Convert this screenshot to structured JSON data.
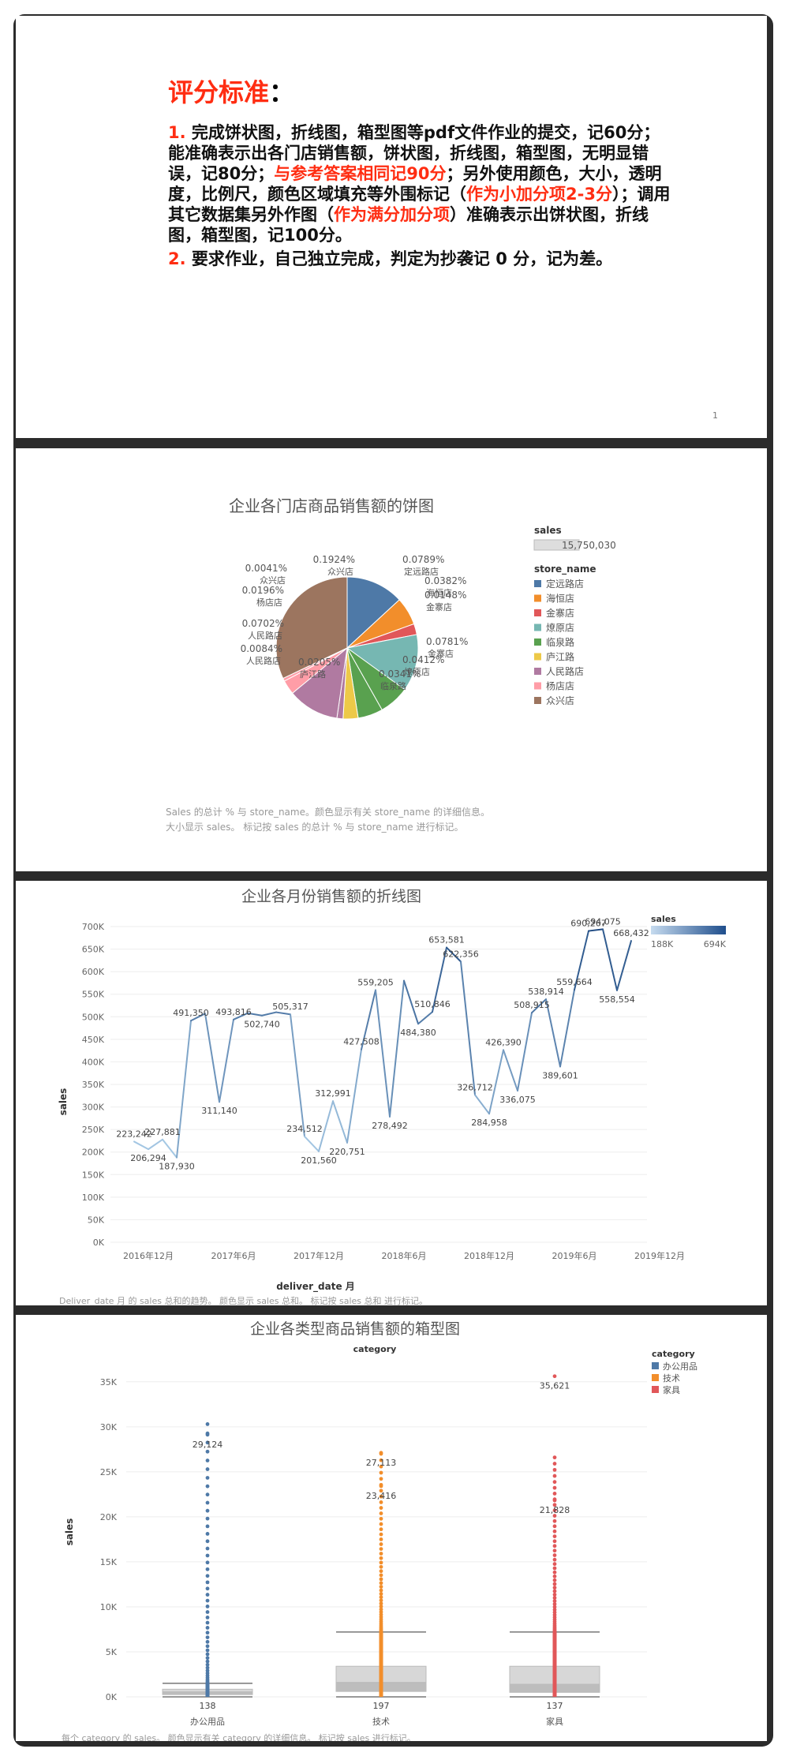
{
  "slide1": {
    "title_red": "评分标准",
    "title_colon": "：",
    "p1": [
      {
        "t": "1. ",
        "red": true
      },
      {
        "t": "完成饼状图，折线图，箱型图等pdf文件作业的提交，记60分；能准确表示出各门店销售额，饼状图，折线图，箱型图，无明显错误，记80分；",
        "red": false
      },
      {
        "t": "与参考答案相同记90分",
        "red": true
      },
      {
        "t": "；另外使用颜色，大小，透明度，比例尺，颜色区域填充等外围标记（",
        "red": false
      },
      {
        "t": "作为小加分项2-3分",
        "red": true
      },
      {
        "t": "）；调用其它数据集另外作图（",
        "red": false
      },
      {
        "t": "作为满分加分项",
        "red": true
      },
      {
        "t": "）准确表示出饼状图，折线图，箱型图，记100分。",
        "red": false
      }
    ],
    "p2": [
      {
        "t": "2. ",
        "red": true
      },
      {
        "t": "要求作业，自己独立完成，判定为抄袭记 0 分，记为差。",
        "red": false
      }
    ],
    "page_number": "1"
  },
  "slide2": {
    "chart_data": {
      "type": "pie",
      "title": "企业各门店商品销售额的饼图",
      "size_legend_title": "sales",
      "size_legend_value": "15,750,030",
      "legend_title": "store_name",
      "legend": [
        {
          "name": "定远路店",
          "color": "#4e79a7"
        },
        {
          "name": "海恒店",
          "color": "#f28e2b"
        },
        {
          "name": "金寨店",
          "color": "#e15759"
        },
        {
          "name": "燎原店",
          "color": "#76b7b2"
        },
        {
          "name": "临泉路",
          "color": "#59a14f"
        },
        {
          "name": "庐江路",
          "color": "#edc948"
        },
        {
          "name": "人民路店",
          "color": "#b07aa1"
        },
        {
          "name": "杨店店",
          "color": "#ff9da7"
        },
        {
          "name": "众兴店",
          "color": "#9c755f"
        }
      ],
      "slices": [
        {
          "name": "定远路店",
          "value": 0.0789,
          "pct": "0.0789%",
          "color": "#4e79a7"
        },
        {
          "name": "海恒店",
          "value": 0.0382,
          "pct": "0.0382%",
          "color": "#f28e2b"
        },
        {
          "name": "金寨店",
          "value": 0.0148,
          "pct": "0.0148%",
          "color": "#e15759"
        },
        {
          "name": "金寨店",
          "value": 0.0781,
          "pct": "0.0781%",
          "color": "#76b7b2"
        },
        {
          "name": "燎原店",
          "value": 0.0412,
          "pct": "0.0412%",
          "color": "#59a14f"
        },
        {
          "name": "临泉路",
          "value": 0.0341,
          "pct": "0.0341%",
          "color": "#59a14f"
        },
        {
          "name": "庐江路",
          "value": 0.0205,
          "pct": "0.0205%",
          "color": "#edc948"
        },
        {
          "name": "人民路店",
          "value": 0.0084,
          "pct": "0.0084%",
          "color": "#b07aa1"
        },
        {
          "name": "人民路店",
          "value": 0.0702,
          "pct": "0.0702%",
          "color": "#b07aa1"
        },
        {
          "name": "杨店店",
          "value": 0.0196,
          "pct": "0.0196%",
          "color": "#ff9da7"
        },
        {
          "name": "众兴店",
          "value": 0.0041,
          "pct": "0.0041%",
          "color": "#ff9da7"
        },
        {
          "name": "众兴店",
          "value": 0.1924,
          "pct": "0.1924%",
          "color": "#9c755f"
        }
      ],
      "footnote": [
        "Sales 的总计 % 与 store_name。颜色显示有关 store_name 的详细信息。",
        "大小显示 sales。 标记按 sales 的总计 % 与 store_name 进行标记。"
      ]
    }
  },
  "slide3": {
    "chart_data": {
      "type": "line",
      "title": "企业各月份销售额的折线图",
      "xlabel": "deliver_date 月",
      "ylabel": "sales",
      "ylim": [
        0,
        700000
      ],
      "yticks": [
        "0K",
        "50K",
        "100K",
        "150K",
        "200K",
        "250K",
        "300K",
        "350K",
        "400K",
        "450K",
        "500K",
        "550K",
        "600K",
        "650K",
        "700K"
      ],
      "xticks": [
        "2016年12月",
        "2017年6月",
        "2017年12月",
        "2018年6月",
        "2018年12月",
        "2019年6月",
        "2019年12月"
      ],
      "legend_title": "sales",
      "legend_min": "188K",
      "legend_max": "694K",
      "x_start": "2016-11",
      "values": [
        223242,
        206294,
        227881,
        187930,
        491350,
        507000,
        311140,
        493816,
        508000,
        502740,
        510000,
        505317,
        234512,
        201560,
        312991,
        220751,
        427508,
        559205,
        278492,
        580000,
        484380,
        510846,
        653581,
        622356,
        326712,
        284958,
        426390,
        336075,
        508915,
        538914,
        389601,
        559664,
        690267,
        694075,
        558554,
        668432
      ],
      "labels": [
        "223,242",
        "206,294",
        "227,881",
        "187,930",
        "491,350",
        "",
        "311,140",
        "493,816",
        "",
        "502,740",
        "",
        "505,317",
        "234,512",
        "201,560",
        "312,991",
        "220,751",
        "427,508",
        "559,205",
        "278,492",
        "",
        "484,380",
        "510,846",
        "653,581",
        "622,356",
        "326,712",
        "284,958",
        "426,390",
        "336,075",
        "508,915",
        "538,914",
        "389,601",
        "559,664",
        "690,267",
        "694,075",
        "558,554",
        "668,432"
      ],
      "footnote": "Deliver_date 月 的 sales 总和的趋势。 颜色显示 sales 总和。 标记按 sales 总和 进行标记。"
    }
  },
  "slide4": {
    "chart_data": {
      "type": "box",
      "title": "企业各类型商品销售额的箱型图",
      "header": "category",
      "ylabel": "sales",
      "ylim": [
        0,
        37000
      ],
      "yticks": [
        "0K",
        "5K",
        "10K",
        "15K",
        "20K",
        "25K",
        "30K",
        "35K"
      ],
      "legend_title": "category",
      "categories": [
        {
          "name": "办公用品",
          "color": "#4e79a7",
          "min_label": "138",
          "q1": 250,
          "median": 550,
          "q3": 850,
          "whisker_high": 1500,
          "labels": [
            {
              "v": 29124,
              "t": "29,124"
            }
          ],
          "outliers_max": 30300
        },
        {
          "name": "技术",
          "color": "#f28e2b",
          "min_label": "197",
          "q1": 600,
          "median": 1600,
          "q3": 3400,
          "whisker_high": 7200,
          "labels": [
            {
              "v": 27113,
              "t": "27,113"
            },
            {
              "v": 23416,
              "t": "23,416"
            }
          ],
          "outliers_max": 27000
        },
        {
          "name": "家具",
          "color": "#e15759",
          "min_label": "137",
          "q1": 500,
          "median": 1400,
          "q3": 3400,
          "whisker_high": 7200,
          "labels": [
            {
              "v": 35621,
              "t": "35,621"
            },
            {
              "v": 21828,
              "t": "21,828"
            }
          ],
          "outliers_max": 26600
        }
      ],
      "footnote": "每个 category 的 sales。 颜色显示有关 category 的详细信息。 标记按 sales 进行标记。"
    }
  }
}
